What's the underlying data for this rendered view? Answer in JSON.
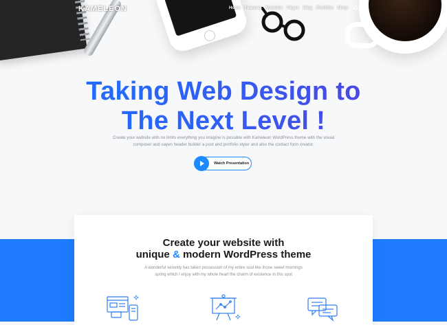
{
  "brand": {
    "logo_text": "KAMELEON"
  },
  "nav": {
    "items": [
      "Home",
      "Features",
      "Modules",
      "Pages",
      "Blog",
      "Portfolio",
      "Shop"
    ]
  },
  "hero": {
    "headline_line1": "Taking Web Design to",
    "headline_line2": "The Next Level !",
    "intro_line1": "Create your website with no limits everything you imagine is possible with Kameleon WordPress theme with the visual",
    "intro_line2": "composer and sayen header builder a post and portfolio styler and also the contact form creator.",
    "button_label": "Watch Presentation"
  },
  "section": {
    "title_line1": "Create your website with",
    "title_unique": "unique",
    "title_amp": "&",
    "title_rest": "modern WordPress theme",
    "subtitle_line1": "A wonderful serenity has taken possession of my entire soul like those sweet mornings",
    "subtitle_line2": "spring which I enjoy with my whole heart the charm of existence in this spot"
  },
  "icons": [
    "notebook-image",
    "pen-image",
    "smartphone-image",
    "glasses-image",
    "coffee-mug-image",
    "search-icon",
    "menu-icon",
    "play-icon",
    "responsive-devices-icon",
    "presentation-chart-icon",
    "chat-bubbles-icon"
  ],
  "colors": {
    "accent_blue": "#1e88ff",
    "band_blue": "#1e7bff",
    "headline_gradient_start": "#1677ff",
    "headline_gradient_end": "#5b3bd8"
  }
}
